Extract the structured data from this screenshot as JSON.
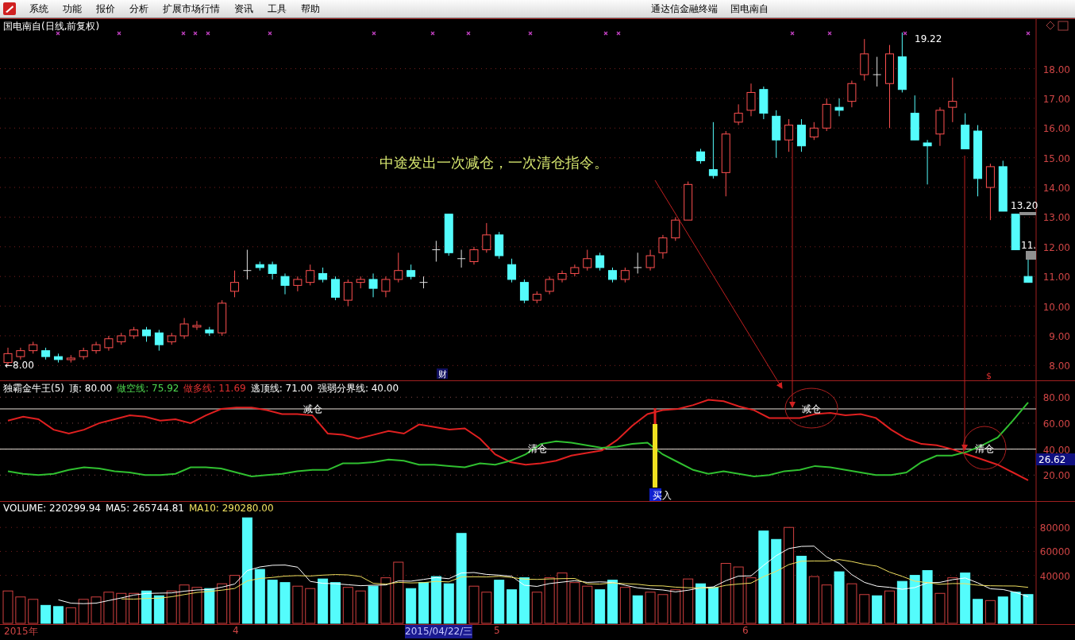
{
  "menu_bar": {
    "items": [
      "系统",
      "功能",
      "报价",
      "分析",
      "扩展市场行情",
      "资讯",
      "工具",
      "帮助"
    ],
    "app_title": "通达信金融终端",
    "stock_title": "国电南自"
  },
  "price_panel": {
    "title": "国电南自(日线,前复权)",
    "annotation": "中途发出一次减仓，一次清仓指令。",
    "high_label": "19.22",
    "low_label": "←8.00",
    "last_labels": [
      "13.20",
      "11."
    ],
    "event_labels": [
      {
        "text": "财",
        "kind": "info"
      },
      {
        "text": "$",
        "kind": "dividend"
      }
    ],
    "chart_data": {
      "type": "candlestick",
      "ylim": [
        7.5,
        19.7
      ],
      "grid": true,
      "yticks": [
        {
          "value": 18,
          "label": "18.00"
        },
        {
          "value": 17,
          "label": "17.00"
        },
        {
          "value": 16,
          "label": "16.00"
        },
        {
          "value": 15,
          "label": "15.00"
        },
        {
          "value": 14,
          "label": "14.00"
        },
        {
          "value": 13,
          "label": "13.00"
        },
        {
          "value": 12,
          "label": "12.00"
        },
        {
          "value": 11,
          "label": "11.00"
        },
        {
          "value": 10,
          "label": "10.00"
        },
        {
          "value": 9,
          "label": "9.00"
        },
        {
          "value": 8,
          "label": "8.00"
        }
      ],
      "ohlc": [
        [
          8.1,
          8.6,
          8.0,
          8.4
        ],
        [
          8.3,
          8.6,
          8.2,
          8.5
        ],
        [
          8.5,
          8.8,
          8.4,
          8.7
        ],
        [
          8.5,
          8.6,
          8.2,
          8.3
        ],
        [
          8.3,
          8.4,
          8.1,
          8.2
        ],
        [
          8.2,
          8.35,
          8.1,
          8.25
        ],
        [
          8.3,
          8.6,
          8.2,
          8.5
        ],
        [
          8.5,
          8.8,
          8.4,
          8.7
        ],
        [
          8.6,
          9.0,
          8.5,
          8.9
        ],
        [
          8.8,
          9.1,
          8.7,
          9.0
        ],
        [
          9.0,
          9.3,
          8.9,
          9.2
        ],
        [
          9.2,
          9.3,
          8.8,
          9.0
        ],
        [
          9.1,
          9.2,
          8.5,
          8.7
        ],
        [
          8.8,
          9.1,
          8.7,
          9.0
        ],
        [
          9.0,
          9.6,
          8.9,
          9.4
        ],
        [
          9.3,
          9.5,
          9.2,
          9.35
        ],
        [
          9.2,
          9.3,
          9.0,
          9.1
        ],
        [
          9.1,
          10.2,
          9.0,
          10.1
        ],
        [
          10.5,
          11.2,
          10.3,
          10.8
        ],
        [
          11.2,
          11.9,
          10.9,
          11.2
        ],
        [
          11.4,
          11.5,
          11.2,
          11.3
        ],
        [
          11.4,
          11.5,
          10.9,
          11.1
        ],
        [
          11.0,
          11.1,
          10.4,
          10.7
        ],
        [
          10.7,
          11.0,
          10.5,
          10.9
        ],
        [
          10.8,
          11.4,
          10.7,
          11.2
        ],
        [
          11.1,
          11.3,
          10.8,
          10.9
        ],
        [
          10.9,
          11.0,
          10.2,
          10.3
        ],
        [
          10.2,
          10.9,
          10.0,
          10.8
        ],
        [
          10.8,
          11.0,
          10.6,
          10.9
        ],
        [
          10.9,
          11.1,
          10.3,
          10.6
        ],
        [
          10.5,
          11.0,
          10.3,
          10.9
        ],
        [
          10.9,
          11.8,
          10.8,
          11.2
        ],
        [
          11.2,
          11.4,
          10.9,
          11.0
        ],
        [
          10.8,
          11.0,
          10.6,
          10.8
        ],
        [
          11.9,
          12.2,
          11.5,
          11.9
        ],
        [
          13.1,
          13.1,
          11.7,
          11.8
        ],
        [
          11.6,
          11.9,
          11.3,
          11.6
        ],
        [
          11.5,
          12.0,
          11.4,
          11.9
        ],
        [
          11.9,
          12.8,
          11.8,
          12.4
        ],
        [
          12.4,
          12.5,
          11.6,
          11.7
        ],
        [
          11.4,
          11.6,
          10.8,
          10.9
        ],
        [
          10.8,
          10.9,
          10.1,
          10.2
        ],
        [
          10.2,
          10.5,
          10.1,
          10.4
        ],
        [
          10.5,
          11.0,
          10.4,
          10.9
        ],
        [
          10.9,
          11.2,
          10.8,
          11.1
        ],
        [
          11.1,
          11.4,
          11.0,
          11.3
        ],
        [
          11.3,
          11.9,
          11.2,
          11.6
        ],
        [
          11.7,
          11.8,
          11.2,
          11.3
        ],
        [
          11.2,
          11.3,
          10.8,
          10.9
        ],
        [
          10.9,
          11.3,
          10.8,
          11.2
        ],
        [
          11.3,
          11.8,
          11.1,
          11.3
        ],
        [
          11.3,
          11.9,
          11.2,
          11.7
        ],
        [
          11.8,
          12.4,
          11.6,
          12.3
        ],
        [
          12.3,
          13.0,
          12.2,
          12.9
        ],
        [
          12.9,
          14.2,
          12.9,
          14.1
        ],
        [
          15.2,
          15.3,
          14.8,
          14.9
        ],
        [
          14.6,
          16.2,
          14.3,
          14.4
        ],
        [
          14.5,
          15.9,
          13.7,
          15.8
        ],
        [
          16.2,
          16.8,
          16.1,
          16.5
        ],
        [
          16.6,
          17.5,
          16.4,
          17.2
        ],
        [
          17.3,
          17.4,
          16.3,
          16.5
        ],
        [
          16.4,
          16.6,
          15.0,
          15.6
        ],
        [
          15.6,
          16.3,
          15.2,
          16.1
        ],
        [
          16.1,
          16.3,
          15.2,
          15.4
        ],
        [
          15.7,
          16.2,
          15.6,
          16.0
        ],
        [
          16.0,
          17.0,
          15.9,
          16.8
        ],
        [
          16.7,
          17.0,
          16.4,
          16.6
        ],
        [
          16.9,
          17.6,
          16.7,
          17.5
        ],
        [
          17.8,
          19.0,
          17.6,
          18.5
        ],
        [
          17.8,
          18.4,
          17.4,
          17.8
        ],
        [
          17.5,
          18.8,
          16.0,
          18.5
        ],
        [
          18.4,
          19.22,
          17.2,
          17.3
        ],
        [
          16.5,
          17.1,
          15.6,
          15.6
        ],
        [
          15.5,
          15.6,
          14.1,
          15.4
        ],
        [
          15.8,
          16.7,
          15.4,
          16.6
        ],
        [
          16.7,
          17.7,
          16.2,
          16.9
        ],
        [
          16.1,
          16.5,
          15.3,
          15.3
        ],
        [
          15.9,
          16.1,
          13.7,
          14.3
        ],
        [
          14.0,
          14.8,
          12.9,
          14.7
        ],
        [
          14.7,
          14.9,
          13.2,
          13.2
        ],
        [
          13.1,
          13.1,
          11.9,
          11.9
        ],
        [
          11.0,
          11.6,
          10.8,
          10.8
        ]
      ]
    }
  },
  "indicator_panel": {
    "name": "独霸金牛王(5)",
    "params": [
      {
        "text": "顶: 80.00",
        "color": "#ffffff"
      },
      {
        "text": "做空线: 75.92",
        "color": "#4fd84f"
      },
      {
        "text": "做多线: 11.69",
        "color": "#e03030"
      },
      {
        "text": "逃顶线: 71.00",
        "color": "#ffffff"
      },
      {
        "text": "强弱分界线: 40.00",
        "color": "#ffffff"
      }
    ],
    "signals": [
      {
        "text": "减仓",
        "kind": "plain"
      },
      {
        "text": "清仓",
        "kind": "plain"
      },
      {
        "text": "减仓",
        "kind": "circled"
      },
      {
        "text": "清仓",
        "kind": "circled"
      }
    ],
    "buy_label": "买入",
    "current_value": "26.62",
    "chart_data": {
      "type": "line",
      "ylim": [
        0,
        93
      ],
      "grid": true,
      "yticks": [
        {
          "value": 80,
          "label": "80.00"
        },
        {
          "value": 60,
          "label": "60.00"
        },
        {
          "value": 40,
          "label": "40.00"
        },
        {
          "value": 20,
          "label": "20.00"
        }
      ],
      "ref_lines": [
        {
          "axis": "y",
          "value": 71
        },
        {
          "axis": "y",
          "value": 40
        }
      ],
      "series": [
        {
          "color": "#e02020",
          "values": [
            62,
            65,
            63,
            55,
            52,
            55,
            60,
            63,
            66,
            65,
            62,
            63,
            60,
            66,
            71,
            72,
            72,
            70,
            67,
            67,
            66,
            52,
            51,
            48,
            51,
            54,
            52,
            59,
            57,
            55,
            56,
            48,
            36,
            30,
            28,
            29,
            31,
            35,
            37,
            39,
            47,
            58,
            67,
            70,
            71,
            74,
            78,
            77,
            73,
            70,
            64,
            64,
            64,
            67,
            68,
            66,
            67,
            64,
            55,
            48,
            44,
            43,
            40,
            36,
            32,
            28,
            22,
            16
          ]
        },
        {
          "color": "#30c030",
          "values": [
            23,
            21,
            20,
            21,
            24,
            26,
            25,
            23,
            22,
            20,
            20,
            21,
            26,
            26,
            25,
            22,
            19,
            20,
            21,
            23,
            24,
            24,
            29,
            29,
            30,
            32,
            31,
            28,
            28,
            27,
            26,
            29,
            28,
            31,
            36,
            44,
            46,
            45,
            43,
            41,
            42,
            44,
            45,
            36,
            30,
            24,
            21,
            23,
            21,
            19,
            20,
            23,
            24,
            27,
            26,
            24,
            22,
            20,
            20,
            22,
            30,
            35,
            35,
            38,
            43,
            49,
            62,
            76
          ]
        }
      ]
    }
  },
  "volume_panel": {
    "params": [
      {
        "text": "VOLUME: 220299.94",
        "color": "#ffffff"
      },
      {
        "text": "MA5: 265744.81",
        "color": "#ffffff"
      },
      {
        "text": "MA10: 290280.00",
        "color": "#f0e060"
      }
    ],
    "chart_data": {
      "type": "bar",
      "ylim": [
        0,
        102000
      ],
      "grid": true,
      "yticks": [
        {
          "value": 80000,
          "label": "80000"
        },
        {
          "value": 60000,
          "label": "60000"
        },
        {
          "value": 40000,
          "label": "40000"
        }
      ],
      "series": [
        {
          "colors": [
            "#d04040",
            "#d04040",
            "#d04040",
            "#54fcfc",
            "#54fcfc",
            "#d04040",
            "#d04040",
            "#d04040",
            "#d04040",
            "#d04040",
            "#d04040",
            "#54fcfc",
            "#54fcfc",
            "#d04040",
            "#d04040",
            "#d04040",
            "#54fcfc",
            "#d04040",
            "#d04040",
            "#54fcfc",
            "#54fcfc",
            "#54fcfc",
            "#54fcfc",
            "#d04040",
            "#d04040",
            "#54fcfc",
            "#54fcfc",
            "#d04040",
            "#d04040",
            "#54fcfc",
            "#d04040",
            "#d04040",
            "#54fcfc",
            "#54fcfc",
            "#54fcfc",
            "#54fcfc",
            "#54fcfc",
            "#d04040",
            "#d04040",
            "#54fcfc",
            "#54fcfc",
            "#54fcfc",
            "#d04040",
            "#d04040",
            "#d04040",
            "#d04040",
            "#d04040",
            "#54fcfc",
            "#54fcfc",
            "#d04040",
            "#54fcfc",
            "#d04040",
            "#d04040",
            "#d04040",
            "#d04040",
            "#54fcfc",
            "#54fcfc",
            "#d04040",
            "#d04040",
            "#d04040",
            "#54fcfc",
            "#54fcfc",
            "#d04040",
            "#54fcfc",
            "#d04040",
            "#d04040",
            "#54fcfc",
            "#d04040",
            "#d04040",
            "#54fcfc",
            "#d04040",
            "#54fcfc",
            "#54fcfc",
            "#54fcfc",
            "#d04040",
            "#d04040",
            "#54fcfc",
            "#54fcfc",
            "#d04040",
            "#54fcfc",
            "#54fcfc",
            "#54fcfc"
          ],
          "values": [
            27000,
            22000,
            20000,
            15000,
            14000,
            13000,
            20000,
            22000,
            26000,
            25000,
            25000,
            27000,
            23000,
            27000,
            32000,
            30000,
            29000,
            33000,
            40000,
            88000,
            45000,
            36000,
            34000,
            31000,
            29000,
            37000,
            34000,
            30000,
            27000,
            31000,
            38000,
            51000,
            29000,
            34000,
            39000,
            33000,
            75000,
            31000,
            26000,
            36000,
            28000,
            38000,
            26000,
            38000,
            42000,
            34000,
            31000,
            28000,
            36000,
            30000,
            23000,
            26000,
            24000,
            28000,
            37000,
            33000,
            30000,
            50000,
            47000,
            38000,
            77000,
            70000,
            80000,
            56000,
            39000,
            32000,
            43000,
            33000,
            24000,
            23000,
            27000,
            35000,
            40000,
            44000,
            25000,
            38000,
            42000,
            20000,
            19000,
            22000,
            26000,
            24000
          ]
        },
        {
          "type": "line",
          "color": "#ffffff",
          "values": [
            null,
            null,
            null,
            null,
            19600,
            16800,
            16400,
            16800,
            19000,
            21200,
            23600,
            25000,
            25200,
            25400,
            26800,
            27800,
            28200,
            30200,
            32800,
            44000,
            47000,
            48400,
            48600,
            46800,
            35000,
            33400,
            33000,
            32200,
            31400,
            31800,
            32000,
            35400,
            35200,
            36600,
            38200,
            37200,
            42000,
            42400,
            40800,
            40200,
            39200,
            31800,
            30800,
            33200,
            34400,
            35600,
            34200,
            34600,
            34200,
            31800,
            29600,
            28600,
            27800,
            26200,
            27600,
            29600,
            30400,
            35600,
            39400,
            39600,
            48400,
            56400,
            62400,
            64200,
            64400,
            55400,
            50000,
            40600,
            34200,
            31000,
            30000,
            28400,
            29800,
            33800,
            34200,
            36400,
            37800,
            33800,
            28800,
            28200,
            25800,
            22200
          ]
        },
        {
          "type": "line",
          "color": "#f0e060",
          "values": [
            null,
            null,
            null,
            null,
            null,
            null,
            null,
            null,
            null,
            20400,
            20200,
            20700,
            21000,
            22200,
            24000,
            25700,
            26600,
            27700,
            29100,
            35400,
            37400,
            38300,
            39400,
            39800,
            39500,
            40200,
            40700,
            40400,
            39100,
            33400,
            32700,
            34200,
            33700,
            34000,
            35000,
            34600,
            38700,
            38800,
            38700,
            39200,
            38200,
            36900,
            36600,
            37000,
            37300,
            37400,
            33000,
            32700,
            33700,
            33100,
            32600,
            31400,
            31200,
            30200,
            29700,
            29600,
            29500,
            31700,
            32800,
            33600,
            39000,
            43400,
            49000,
            51800,
            52000,
            51900,
            53200,
            51500,
            49200,
            47700,
            42700,
            39200,
            35200,
            34000,
            32600,
            33200,
            33100,
            31800,
            31300,
            31200,
            31100,
            30000
          ]
        }
      ]
    }
  },
  "date_axis": {
    "labels": [
      {
        "text": "2015年",
        "selected": false
      },
      {
        "text": "4",
        "selected": false
      },
      {
        "text": "2015/04/22/三",
        "selected": true
      },
      {
        "text": "5",
        "selected": false
      },
      {
        "text": "6",
        "selected": false
      }
    ]
  }
}
